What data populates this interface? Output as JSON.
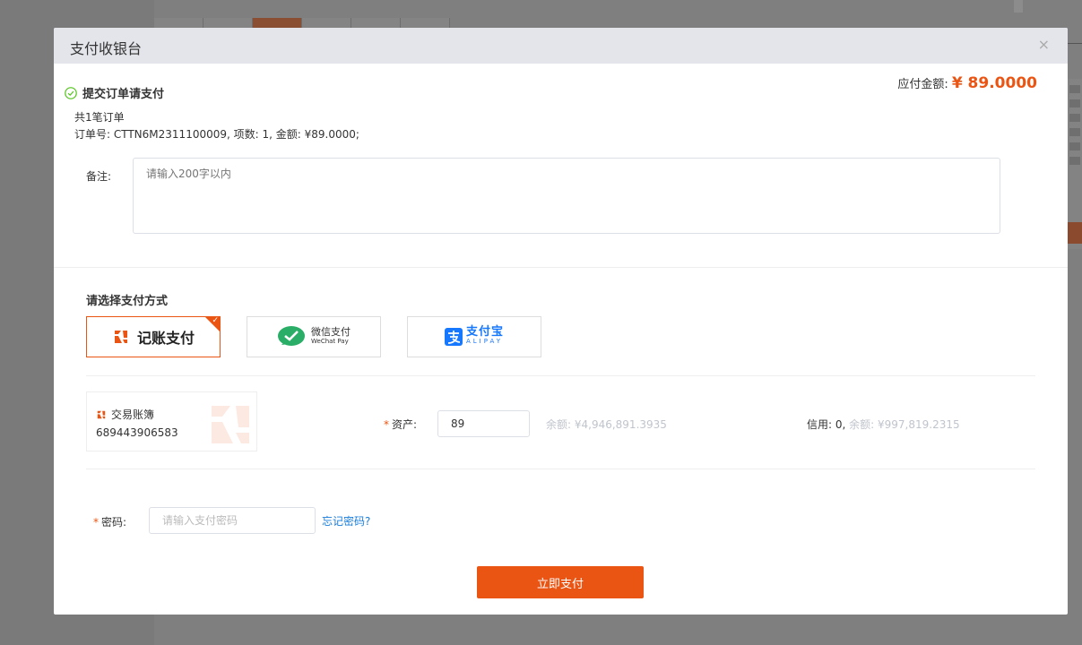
{
  "modal": {
    "title": "支付收银台",
    "close": "×"
  },
  "payable": {
    "label": "应付金额:",
    "amount": "¥ 89.0000"
  },
  "order": {
    "heading": "提交订单请支付",
    "count_text": "共1笔订单",
    "detail_text": "订单号: CTTN6M2311100009, 项数: 1, 金额: ¥89.0000;"
  },
  "remark": {
    "label": "备注:",
    "placeholder": "请输入200字以内"
  },
  "payment": {
    "section_title": "请选择支付方式",
    "options": [
      {
        "label": "记账支付",
        "selected": true
      },
      {
        "label_cn": "微信支付",
        "label_en": "WeChat Pay",
        "selected": false
      },
      {
        "label_cn": "支付宝",
        "label_en": "ALIPAY",
        "selected": false
      }
    ]
  },
  "account": {
    "name": "交易账簿",
    "number": "689443906583"
  },
  "asset": {
    "required_mark": "*",
    "label": "资产:",
    "value": "89",
    "balance": "余额: ¥4,946,891.3935"
  },
  "credit": {
    "label": "信用: 0,",
    "balance": "余额: ¥997,819.2315"
  },
  "password": {
    "required_mark": "*",
    "label": "密码:",
    "placeholder": "请输入支付密码",
    "forgot": "忘记密码?"
  },
  "submit": {
    "label": "立即支付"
  },
  "colors": {
    "accent": "#ea5514",
    "link": "#1a7ddb",
    "header_bg": "#e3e5ea"
  }
}
